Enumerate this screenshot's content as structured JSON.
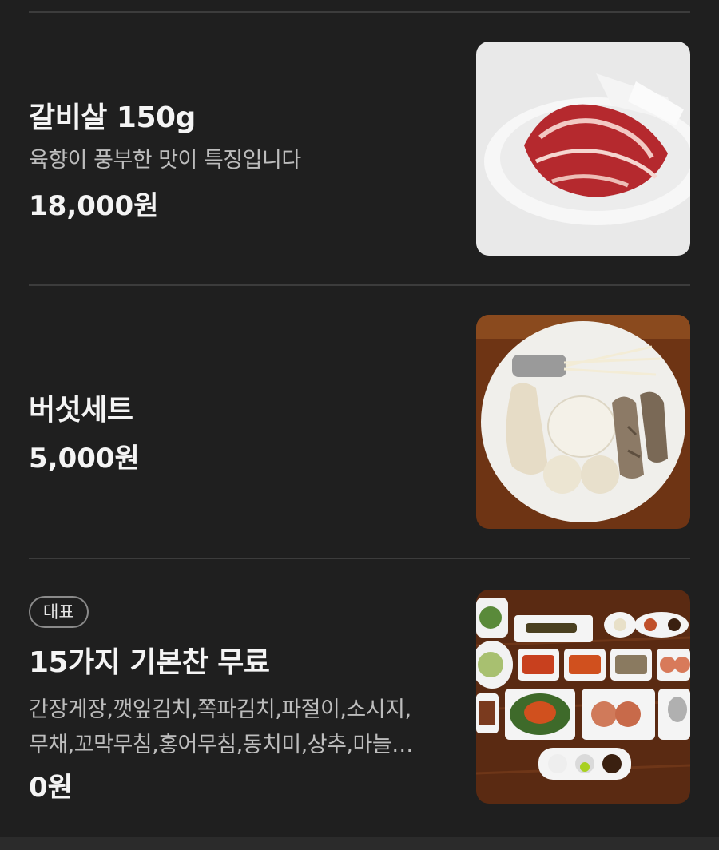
{
  "menu_items": [
    {
      "name": "갈비살 150g",
      "description": "육향이 풍부한 맛이 특징입니다",
      "price": "18,000원",
      "image_icon": "beef-rib-plate-photo"
    },
    {
      "name": "버섯세트",
      "price": "5,000원",
      "image_icon": "mushroom-set-plate-photo"
    },
    {
      "badge": "대표",
      "name": "15가지 기본찬 무료",
      "description_line1": "간장게장,깻잎김치,쪽파김치,파절이,소시지,",
      "description_line2": "무채,꼬막무침,홍어무침,동치미,상추,마늘…",
      "price": "0원",
      "image_icon": "side-dishes-table-photo"
    }
  ]
}
